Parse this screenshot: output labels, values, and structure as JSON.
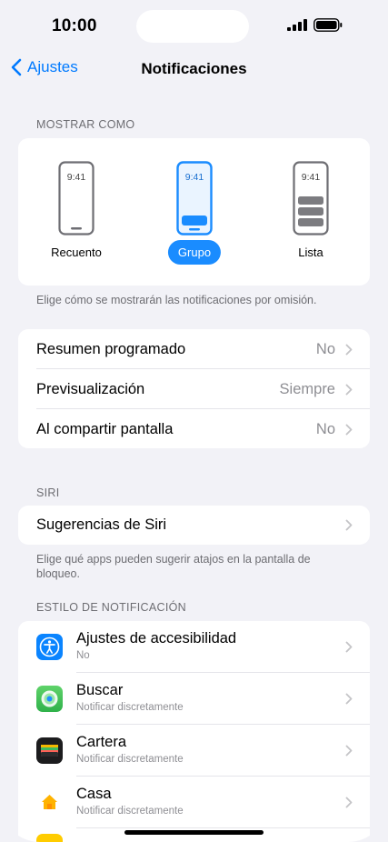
{
  "status": {
    "time": "10:00"
  },
  "nav": {
    "back_label": "Ajustes",
    "title": "Notificaciones"
  },
  "display_as": {
    "header": "MOSTRAR COMO",
    "options": [
      {
        "label": "Recuento",
        "time": "9:41",
        "selected": false
      },
      {
        "label": "Grupo",
        "time": "9:41",
        "selected": true
      },
      {
        "label": "Lista",
        "time": "9:41",
        "selected": false
      }
    ],
    "footnote": "Elige cómo se mostrarán las notificaciones por omisión."
  },
  "general": {
    "rows": [
      {
        "label": "Resumen programado",
        "value": "No"
      },
      {
        "label": "Previsualización",
        "value": "Siempre"
      },
      {
        "label": "Al compartir pantalla",
        "value": "No"
      }
    ]
  },
  "siri": {
    "header": "SIRI",
    "row_label": "Sugerencias de Siri",
    "footnote": "Elige qué apps pueden sugerir atajos en la pantalla de bloqueo."
  },
  "notification_style": {
    "header": "ESTILO DE NOTIFICACIÓN",
    "apps": [
      {
        "name": "Ajustes de accesibilidad",
        "subtitle": "No",
        "icon": "accessibility-icon"
      },
      {
        "name": "Buscar",
        "subtitle": "Notificar discretamente",
        "icon": "find-my-icon"
      },
      {
        "name": "Cartera",
        "subtitle": "Notificar discretamente",
        "icon": "wallet-icon"
      },
      {
        "name": "Casa",
        "subtitle": "Notificar discretamente",
        "icon": "home-icon"
      }
    ]
  },
  "colors": {
    "accent": "#007aff",
    "selected_pill": "#1a8cff",
    "background": "#f2f2f7"
  }
}
